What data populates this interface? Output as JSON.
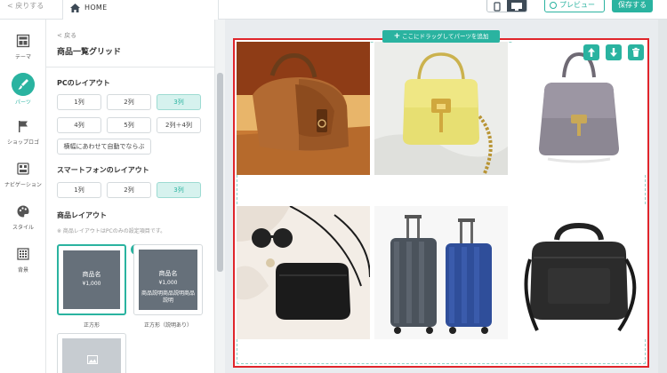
{
  "topbar": {
    "back_label": "< 戻りする",
    "home_label": "HOME",
    "preview_label": "プレビュー",
    "save_label": "保存する"
  },
  "rail": {
    "items": [
      {
        "label": "テーマ",
        "icon": "layout-icon"
      },
      {
        "label": "パーツ",
        "icon": "brush-icon"
      },
      {
        "label": "ショップロゴ",
        "icon": "flag-icon"
      },
      {
        "label": "ナビゲーション",
        "icon": "navigation-icon"
      },
      {
        "label": "スタイル",
        "icon": "palette-icon"
      },
      {
        "label": "背景",
        "icon": "texture-icon"
      }
    ]
  },
  "panel": {
    "back_label": "< 戻る",
    "title": "商品一覧グリッド",
    "pc_layout_title": "PCのレイアウト",
    "pc_options": [
      "1列",
      "2列",
      "3列",
      "4列",
      "5列",
      "2列＋4列",
      "横幅にあわせて自動でならぶ"
    ],
    "sp_layout_title": "スマートフォンのレイアウト",
    "sp_options": [
      "1列",
      "2列",
      "3列"
    ],
    "product_layout_title": "商品レイアウト",
    "product_layout_note": "※ 商品レイアウトはPCのみの設定項目です。",
    "cards": [
      {
        "name": "商品名",
        "price": "¥1,000",
        "caption": "正方形"
      },
      {
        "name": "商品名",
        "price": "¥1,000",
        "desc": "商品説明商品説明商品説明",
        "caption": "正方形（説明あり）"
      }
    ]
  },
  "canvas": {
    "drop_label": "ここにドラッグしてパーツを追加",
    "products": [
      {
        "icon": "brown-shoulder-bag"
      },
      {
        "icon": "yellow-chain-handbag"
      },
      {
        "icon": "gray-handbag"
      },
      {
        "icon": "black-crossbody-bag"
      },
      {
        "icon": "suitcases"
      },
      {
        "icon": "black-business-bag"
      }
    ]
  },
  "colors": {
    "accent": "#2ab3a0",
    "selection_border": "#e0252b"
  }
}
